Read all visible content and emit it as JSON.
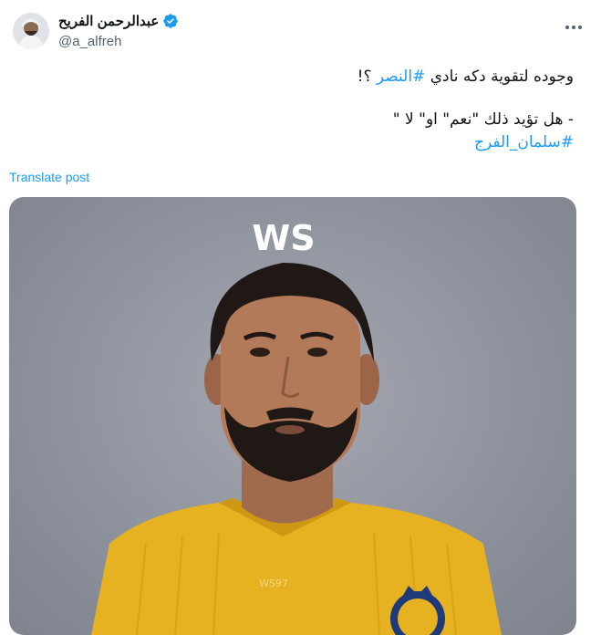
{
  "author": {
    "display_name": "عبدالرحمن الفريح",
    "handle": "@a_alfreh",
    "verified": true
  },
  "tweet": {
    "line1_text": "وجوده لتقوية دكه نادي ",
    "line1_hashtag": "#النصر",
    "line1_suffix": " ؟!",
    "line2_text": "- هل تؤيد ذلك \"نعم\" او\" لا \"",
    "line3_hashtag": "#سلمان_الفرج"
  },
  "actions": {
    "translate_label": "Translate post"
  },
  "media": {
    "image_description_icon": "photo-of-player",
    "watermark": "WS",
    "shirt_mark": "WS97"
  },
  "colors": {
    "accent": "#1d9bf0",
    "text": "#0f1419",
    "secondary": "#536471"
  }
}
